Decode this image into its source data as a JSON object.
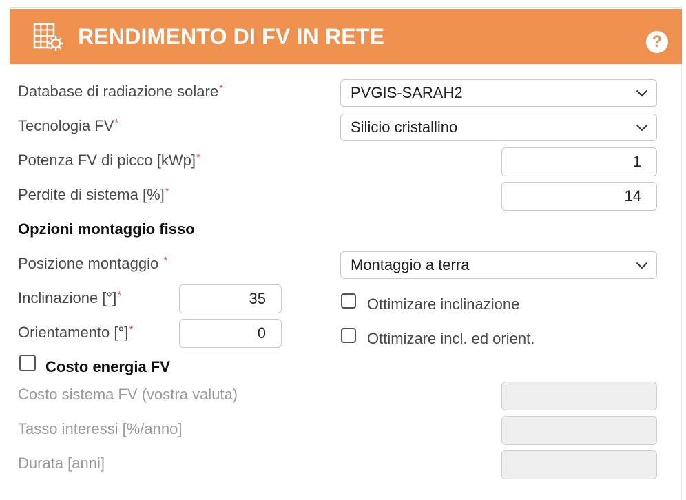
{
  "header": {
    "title": "RENDIMENTO DI FV IN RETE",
    "help_glyph": "?",
    "icon": "solar-panel-icon",
    "accent_color": "#ee914f"
  },
  "required_mark": "*",
  "fields": {
    "database": {
      "label": "Database di radiazione solare",
      "value": "PVGIS-SARAH2"
    },
    "technology": {
      "label": "Tecnologia FV",
      "value": "Silicio cristallino"
    },
    "peak_power": {
      "label": "Potenza FV di picco [kWp]",
      "value": "1"
    },
    "losses": {
      "label": "Perdite di sistema [%]",
      "value": "14"
    }
  },
  "fixed_mount": {
    "section_title": "Opzioni montaggio fisso",
    "position": {
      "label": "Posizione montaggio ",
      "value": "Montaggio a terra"
    },
    "slope": {
      "label": "Inclinazione [°]",
      "value": "35"
    },
    "azimuth": {
      "label": "Orientamento [°]",
      "value": "0"
    },
    "optimize_slope": {
      "label": "Ottimizare inclinazione",
      "checked": false
    },
    "optimize_both": {
      "label": "Ottimizare incl. ed orient.",
      "checked": false
    }
  },
  "cost": {
    "section_title": "Costo energia FV",
    "checked": false,
    "system_cost": {
      "label": "Costo sistema FV (vostra valuta)",
      "value": ""
    },
    "interest": {
      "label": "Tasso interessi [%/anno]",
      "value": ""
    },
    "lifetime": {
      "label": "Durata [anni]",
      "value": ""
    }
  }
}
